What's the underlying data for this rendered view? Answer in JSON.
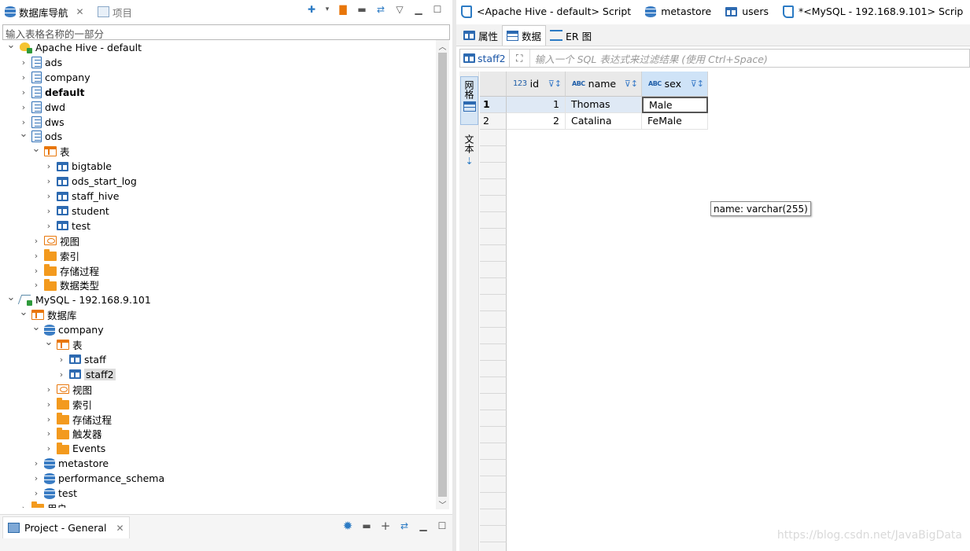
{
  "left": {
    "tab_navigator": "数据库导航",
    "tab_project": "项目",
    "filter_placeholder": "输入表格名称的一部分",
    "tree": [
      {
        "label": "Apache Hive - default",
        "icon": "hive-icon",
        "depth": 0,
        "expanded": true
      },
      {
        "label": "ads",
        "icon": "schema-icon",
        "depth": 1,
        "expanded": false
      },
      {
        "label": "company",
        "icon": "schema-icon",
        "depth": 1,
        "expanded": false
      },
      {
        "label": "default",
        "icon": "schema-icon",
        "depth": 1,
        "expanded": false,
        "bold": true
      },
      {
        "label": "dwd",
        "icon": "schema-icon",
        "depth": 1,
        "expanded": false
      },
      {
        "label": "dws",
        "icon": "schema-icon",
        "depth": 1,
        "expanded": false
      },
      {
        "label": "ods",
        "icon": "schema-icon",
        "depth": 1,
        "expanded": true
      },
      {
        "label": "表",
        "icon": "tables-folder-icon",
        "depth": 2,
        "expanded": true
      },
      {
        "label": "bigtable",
        "icon": "table-icon",
        "depth": 3,
        "expanded": false
      },
      {
        "label": "ods_start_log",
        "icon": "table-icon",
        "depth": 3,
        "expanded": false
      },
      {
        "label": "staff_hive",
        "icon": "table-icon",
        "depth": 3,
        "expanded": false
      },
      {
        "label": "student",
        "icon": "table-icon",
        "depth": 3,
        "expanded": false
      },
      {
        "label": "test",
        "icon": "table-icon",
        "depth": 3,
        "expanded": false
      },
      {
        "label": "视图",
        "icon": "view-icon",
        "depth": 2,
        "expanded": false
      },
      {
        "label": "索引",
        "icon": "folder-icon",
        "depth": 2,
        "expanded": false
      },
      {
        "label": "存储过程",
        "icon": "folder-icon",
        "depth": 2,
        "expanded": false
      },
      {
        "label": "数据类型",
        "icon": "folder-icon",
        "depth": 2,
        "expanded": false
      },
      {
        "label": "MySQL - 192.168.9.101",
        "icon": "mysql-icon",
        "depth": 0,
        "expanded": true
      },
      {
        "label": "数据库",
        "icon": "tables-folder-icon",
        "depth": 1,
        "expanded": true
      },
      {
        "label": "company",
        "icon": "database-icon",
        "depth": 2,
        "expanded": true
      },
      {
        "label": "表",
        "icon": "tables-folder-icon",
        "depth": 3,
        "expanded": true
      },
      {
        "label": "staff",
        "icon": "table-icon",
        "depth": 4,
        "expanded": false
      },
      {
        "label": "staff2",
        "icon": "table-icon",
        "depth": 4,
        "expanded": false,
        "selected": true
      },
      {
        "label": "视图",
        "icon": "view-icon",
        "depth": 3,
        "expanded": false
      },
      {
        "label": "索引",
        "icon": "folder-icon",
        "depth": 3,
        "expanded": false
      },
      {
        "label": "存储过程",
        "icon": "folder-icon",
        "depth": 3,
        "expanded": false
      },
      {
        "label": "触发器",
        "icon": "folder-icon",
        "depth": 3,
        "expanded": false
      },
      {
        "label": "Events",
        "icon": "folder-icon",
        "depth": 3,
        "expanded": false
      },
      {
        "label": "metastore",
        "icon": "database-icon",
        "depth": 2,
        "expanded": false
      },
      {
        "label": "performance_schema",
        "icon": "database-icon",
        "depth": 2,
        "expanded": false
      },
      {
        "label": "test",
        "icon": "database-icon",
        "depth": 2,
        "expanded": false
      },
      {
        "label": "用户",
        "icon": "users-folder-icon",
        "depth": 1,
        "expanded": false
      }
    ],
    "project_tab": "Project - General"
  },
  "editor_tabs": [
    {
      "label": "<Apache Hive - default> Script",
      "icon": "script-icon"
    },
    {
      "label": "metastore",
      "icon": "database-icon"
    },
    {
      "label": "users",
      "icon": "table-icon"
    },
    {
      "label": "*<MySQL - 192.168.9.101> Scrip",
      "icon": "script-icon"
    }
  ],
  "sub_tabs": [
    {
      "label": "属性",
      "icon": "properties-icon"
    },
    {
      "label": "数据",
      "icon": "data-icon",
      "active": true
    },
    {
      "label": "ER 图",
      "icon": "er-diagram-icon"
    }
  ],
  "filter": {
    "table_name": "staff2",
    "placeholder": "输入一个 SQL 表达式来过滤结果 (使用 Ctrl+Space)"
  },
  "side_tabs": {
    "grid": "网格",
    "text": "文本"
  },
  "grid": {
    "columns": [
      {
        "name": "id",
        "type_badge": "123"
      },
      {
        "name": "name",
        "type_badge": "ABC"
      },
      {
        "name": "sex",
        "type_badge": "ABC"
      }
    ],
    "rows": [
      {
        "num": "1",
        "cells": [
          "1",
          "Thomas",
          "Male"
        ]
      },
      {
        "num": "2",
        "cells": [
          "2",
          "Catalina",
          "FeMale"
        ]
      }
    ],
    "tooltip": "name: varchar(255)"
  },
  "watermark": "https://blog.csdn.net/JavaBigData"
}
